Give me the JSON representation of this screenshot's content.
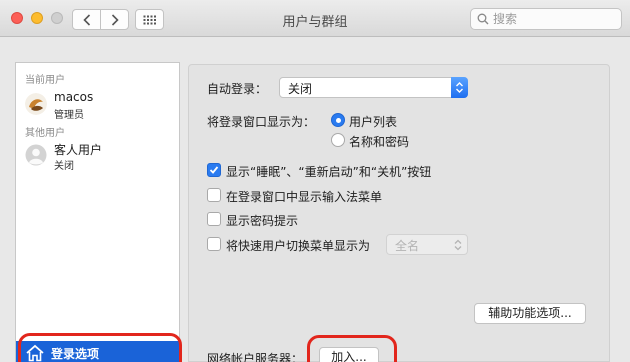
{
  "window": {
    "title": "用户与群组"
  },
  "search": {
    "placeholder": "搜索"
  },
  "sidebar": {
    "current_users_label": "当前用户",
    "current_user": {
      "name": "macos",
      "role": "管理员"
    },
    "other_users_label": "其他用户",
    "guest_user": {
      "name": "客人用户",
      "status": "关闭"
    },
    "login_options_label": "登录选项"
  },
  "main": {
    "auto_login": {
      "label": "自动登录：",
      "value": "关闭"
    },
    "login_window_display": {
      "label": "将登录窗口显示为：",
      "options": [
        {
          "label": "用户列表",
          "selected": true
        },
        {
          "label": "名称和密码",
          "selected": false
        }
      ]
    },
    "checkboxes": [
      {
        "label": "显示“睡眠”、“重新启动”和“关机”按钮",
        "checked": true
      },
      {
        "label": "在登录窗口中显示输入法菜单",
        "checked": false
      },
      {
        "label": "显示密码提示",
        "checked": false
      },
      {
        "label": "将快速用户切换菜单显示为",
        "checked": false
      }
    ],
    "fast_switch_select": {
      "value": "全名"
    },
    "accessibility_button": "辅助功能选项...",
    "network_server": {
      "label": "网络帐户服务器：",
      "join_button": "加入..."
    }
  },
  "colors": {
    "accent": "#1a63d8",
    "highlight_ring": "#e2261c"
  }
}
